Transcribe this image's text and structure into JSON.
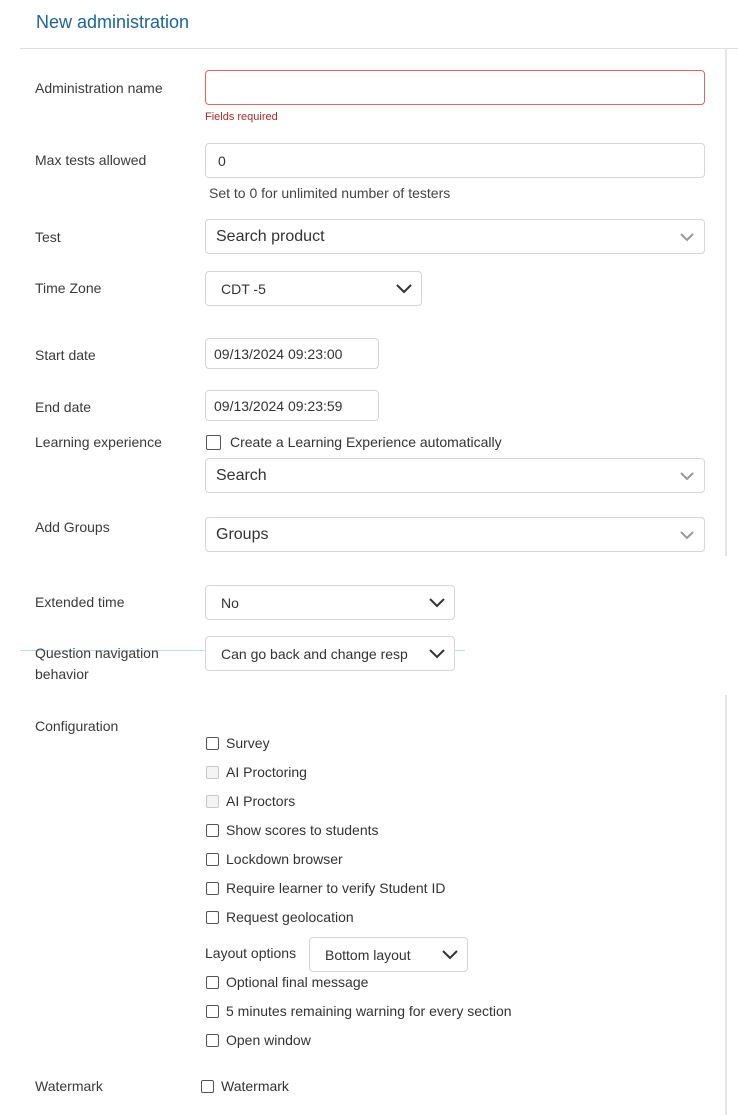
{
  "page": {
    "title": "New administration"
  },
  "admin_name": {
    "label": "Administration name",
    "value": "",
    "error": "Fields required"
  },
  "max_tests": {
    "label": "Max tests allowed",
    "value": "0",
    "hint": "Set to 0 for unlimited number of testers"
  },
  "test": {
    "label": "Test",
    "value": "Search product"
  },
  "time_zone": {
    "label": "Time Zone",
    "value": "CDT -5"
  },
  "start_date": {
    "label": "Start date",
    "value": "09/13/2024 09:23:00"
  },
  "end_date": {
    "label": "End date",
    "value": "09/13/2024 09:23:59"
  },
  "learning": {
    "label": "Learning experience",
    "checkbox_label": "Create a Learning Experience automatically",
    "search_value": "Search"
  },
  "groups": {
    "label": "Add Groups",
    "value": "Groups"
  },
  "extended_time": {
    "label": "Extended time",
    "value": "No"
  },
  "navigation": {
    "label_line1": "Question navigation",
    "label_line2": "behavior",
    "value": "Can go back and change resp"
  },
  "configuration": {
    "label": "Configuration",
    "options": [
      {
        "label": "Survey",
        "checked": false,
        "disabled": false
      },
      {
        "label": "AI Proctoring",
        "checked": false,
        "disabled": true
      },
      {
        "label": "AI Proctors",
        "checked": false,
        "disabled": true
      },
      {
        "label": "Show scores to students",
        "checked": false,
        "disabled": false
      },
      {
        "label": "Lockdown browser",
        "checked": false,
        "disabled": false
      },
      {
        "label": "Require learner to verify Student ID",
        "checked": false,
        "disabled": false
      },
      {
        "label": "Request geolocation",
        "checked": false,
        "disabled": false
      }
    ],
    "layout_label": "Layout options",
    "layout_value": "Bottom layout",
    "options_after": [
      {
        "label": "Optional final message",
        "checked": false,
        "disabled": false
      },
      {
        "label": "5 minutes remaining warning for every section",
        "checked": false,
        "disabled": false
      },
      {
        "label": "Open window",
        "checked": false,
        "disabled": false
      }
    ]
  },
  "watermark": {
    "label": "Watermark",
    "checkbox_label": "Watermark"
  },
  "colors": {
    "title": "#1a6696",
    "error": "#b02a2a",
    "error_border": "#e06565"
  },
  "icons": {
    "dropdown": "chevron-down-icon",
    "checkbox": "checkbox-icon"
  }
}
